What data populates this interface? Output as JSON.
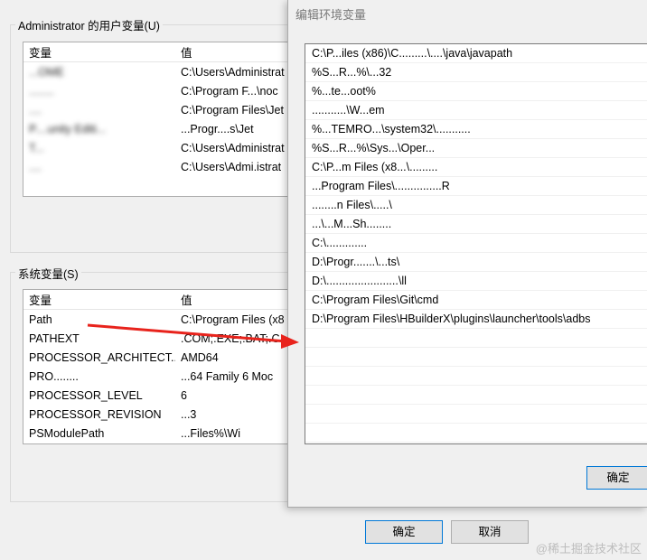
{
  "user_vars": {
    "group_title": "Administrator 的用户变量(U)",
    "headers": {
      "name": "变量",
      "value": "值"
    },
    "rows": [
      {
        "name": "...OME",
        "value": "C:\\Users\\Administrat",
        "blur_name": true
      },
      {
        "name": "........",
        "value": "C:\\Program F...\\noc",
        "blur_name": true
      },
      {
        "name": "....",
        "value": "C:\\Program Files\\Jet",
        "blur_name": true
      },
      {
        "name": "P....unity Editi...",
        "value": "...Progr....s\\Jet",
        "blur_name": true
      },
      {
        "name": "T...",
        "value": "C:\\Users\\Administrat",
        "blur_name": true
      },
      {
        "name": "....",
        "value": "C:\\Users\\Admi.istrat",
        "blur_name": true
      }
    ]
  },
  "system_vars": {
    "group_title": "系统变量(S)",
    "headers": {
      "name": "变量",
      "value": "值"
    },
    "rows": [
      {
        "name": "Path",
        "value": "C:\\Program Files (x8"
      },
      {
        "name": "PATHEXT",
        "value": ".COM;.EXE;.BAT;.C"
      },
      {
        "name": "PROCESSOR_ARCHITECT...",
        "value": "AMD64"
      },
      {
        "name": "PRO........",
        "value": "...64 Family 6 Moc"
      },
      {
        "name": "PROCESSOR_LEVEL",
        "value": "6"
      },
      {
        "name": "PROCESSOR_REVISION",
        "value": "...3"
      },
      {
        "name": "PSModulePath",
        "value": "...Files%\\Wi"
      }
    ]
  },
  "main_buttons": {
    "ok": "确定",
    "cancel": "取消"
  },
  "dialog": {
    "title": "编辑环境变量",
    "paths": [
      "C:\\P...iles (x86)\\C.........\\....\\java\\javapath",
      "%S...R...%\\...32",
      "%...te...oot%",
      "...........\\W...em",
      "%...TEMRO...\\system32\\...........",
      "%S...R...%\\Sys...\\Oper...",
      "C:\\P...m Files (x8...\\.........",
      "...Program Files\\...............R",
      "........n Files\\.....\\",
      "...\\...M...Sh........",
      "C:\\.............",
      "D:\\Progr.......\\...ts\\",
      "D:\\.......................\\ll",
      "C:\\Program Files\\Git\\cmd",
      "D:\\Program Files\\HBuilderX\\plugins\\launcher\\tools\\adbs",
      "",
      "",
      "",
      "",
      "",
      ""
    ],
    "ok_label": "确定"
  },
  "watermark": "@稀土掘金技术社区",
  "colors": {
    "arrow": "#e8231c",
    "selection": "#cce8ff",
    "accent": "#0078d7"
  }
}
